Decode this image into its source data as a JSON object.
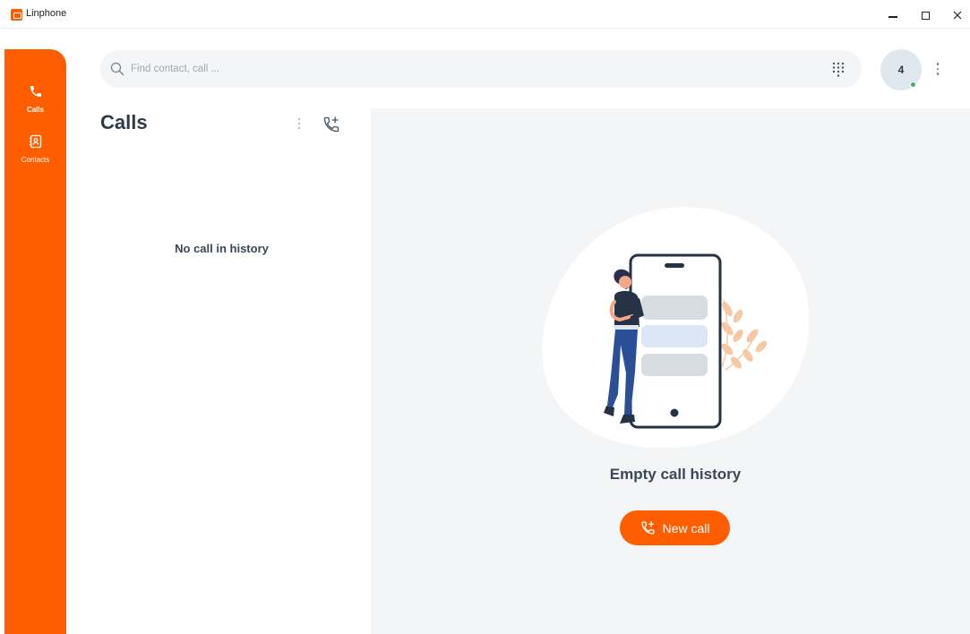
{
  "window": {
    "title": "Linphone",
    "accent_color": "#fe5e00"
  },
  "sidebar": {
    "items": [
      {
        "label": "Calls",
        "icon": "phone-icon",
        "active": true
      },
      {
        "label": "Contacts",
        "icon": "contacts-icon",
        "active": false
      }
    ]
  },
  "search": {
    "placeholder": "Find contact, call ...",
    "value": "",
    "dialpad_icon": "dialpad-icon"
  },
  "account": {
    "avatar_text": "4",
    "presence_color": "#4aa96c"
  },
  "calls_list": {
    "title": "Calls",
    "empty_text": "No call in history"
  },
  "main": {
    "empty_title": "Empty call history",
    "new_call_label": "New call"
  }
}
